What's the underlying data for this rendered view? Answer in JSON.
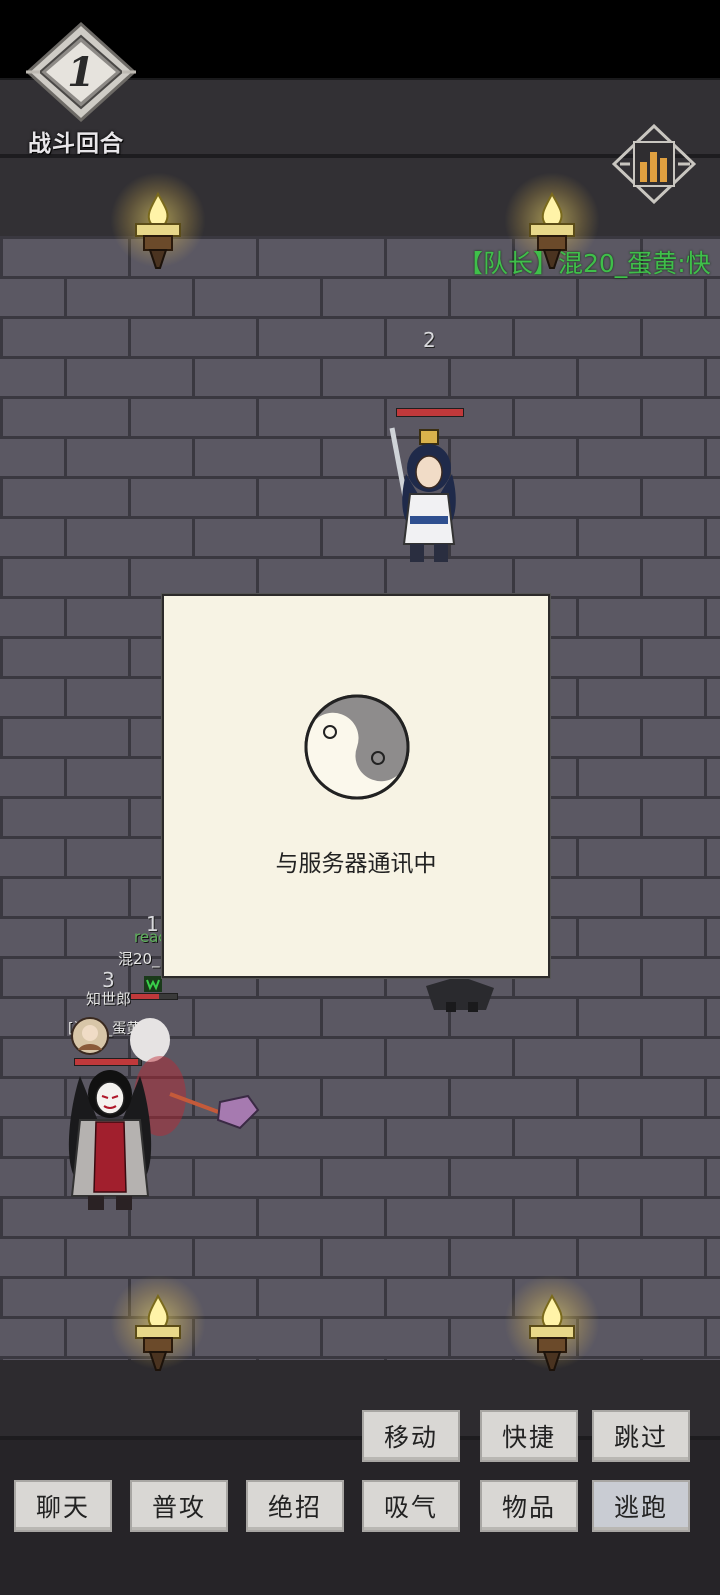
{
  "round": {
    "number": "1",
    "label": "战斗回合"
  },
  "chat": {
    "line": "【队长】混20_蛋黄:快"
  },
  "enemy": {
    "turn_order": "2",
    "hp_fraction": 1.0
  },
  "party": {
    "turn_order_1": "1",
    "status_1": "reac",
    "name_1": "混20_",
    "turn_order_3": "3",
    "name_3": "知世郎",
    "leader_tag": "[混20_蛋黄]",
    "hp_fraction_3": 0.6,
    "hp_fraction_main": 0.95
  },
  "dialog": {
    "message": "与服务器通讯中"
  },
  "actions": {
    "row1": [
      "移动",
      "快捷",
      "跳过"
    ],
    "row2": [
      "聊天",
      "普攻",
      "绝招",
      "吸气",
      "物品",
      "逃跑"
    ]
  },
  "icons": {
    "round_badge": "diamond-round-icon",
    "stats": "bar-chart-icon",
    "torch": "torch-icon",
    "loading": "yin-yang-icon"
  }
}
